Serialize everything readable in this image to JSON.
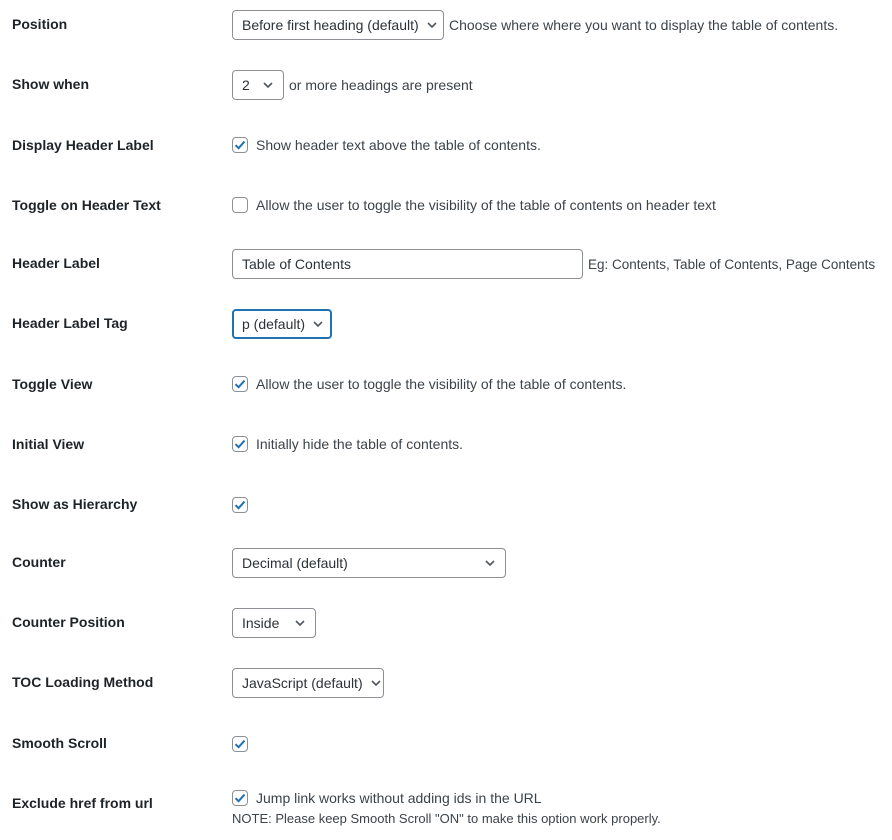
{
  "settings": {
    "position": {
      "label": "Position",
      "selected": "Before first heading (default)",
      "description": "Choose where where you want to display the table of contents."
    },
    "show_when": {
      "label": "Show when",
      "selected": "2",
      "description": "or more headings are present"
    },
    "display_header_label": {
      "label": "Display Header Label",
      "checked": true,
      "description": "Show header text above the table of contents."
    },
    "toggle_on_header_text": {
      "label": "Toggle on Header Text",
      "checked": false,
      "description": "Allow the user to toggle the visibility of the table of contents on header text"
    },
    "header_label": {
      "label": "Header Label",
      "value": "Table of Contents",
      "description": "Eg: Contents, Table of Contents, Page Contents"
    },
    "header_label_tag": {
      "label": "Header Label Tag",
      "selected": "p (default)"
    },
    "toggle_view": {
      "label": "Toggle View",
      "checked": true,
      "description": "Allow the user to toggle the visibility of the table of contents."
    },
    "initial_view": {
      "label": "Initial View",
      "checked": true,
      "description": "Initially hide the table of contents."
    },
    "show_as_hierarchy": {
      "label": "Show as Hierarchy",
      "checked": true
    },
    "counter": {
      "label": "Counter",
      "selected": "Decimal (default)"
    },
    "counter_position": {
      "label": "Counter Position",
      "selected": "Inside"
    },
    "toc_loading_method": {
      "label": "TOC Loading Method",
      "selected": "JavaScript (default)"
    },
    "smooth_scroll": {
      "label": "Smooth Scroll",
      "checked": true
    },
    "exclude_href": {
      "label": "Exclude href from url",
      "checked": true,
      "description": "Jump link works without adding ids in the URL",
      "note": "NOTE: Please keep Smooth Scroll \"ON\" to make this option work properly."
    }
  },
  "colors": {
    "accent": "#2271b1",
    "border": "#8c8f94",
    "label_text": "#1d2327",
    "body_text": "#3c434a"
  }
}
